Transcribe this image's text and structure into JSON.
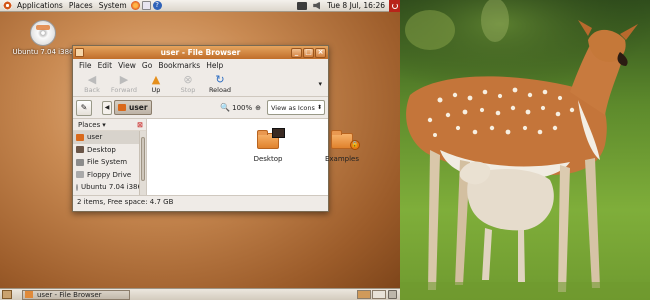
{
  "top_panel": {
    "menus": [
      "Applications",
      "Places",
      "System"
    ],
    "clock": "Tue  8 Jul, 16:26"
  },
  "desktop": {
    "cd_label": "Ubuntu 7.04 i386"
  },
  "file_browser": {
    "title": "user - File Browser",
    "menu": [
      "File",
      "Edit",
      "View",
      "Go",
      "Bookmarks",
      "Help"
    ],
    "toolbar": {
      "back": "Back",
      "forward": "Forward",
      "up": "Up",
      "stop": "Stop",
      "reload": "Reload"
    },
    "location": {
      "current": "user",
      "zoom": "100%",
      "view_mode": "View as Icons"
    },
    "sidebar": {
      "header": "Places",
      "items": [
        "user",
        "Desktop",
        "File System",
        "Floppy Drive",
        "Ubuntu 7.04 i386"
      ]
    },
    "files": [
      "Desktop",
      "Examples"
    ],
    "status": "2 items, Free space: 4.7 GB"
  },
  "taskbar": {
    "window_button": "user - File Browser"
  },
  "colors": {
    "desktop_brown": "#9c5c2a",
    "titlebar_orange": "#d08038",
    "ubuntu_orange": "#d9691b"
  }
}
